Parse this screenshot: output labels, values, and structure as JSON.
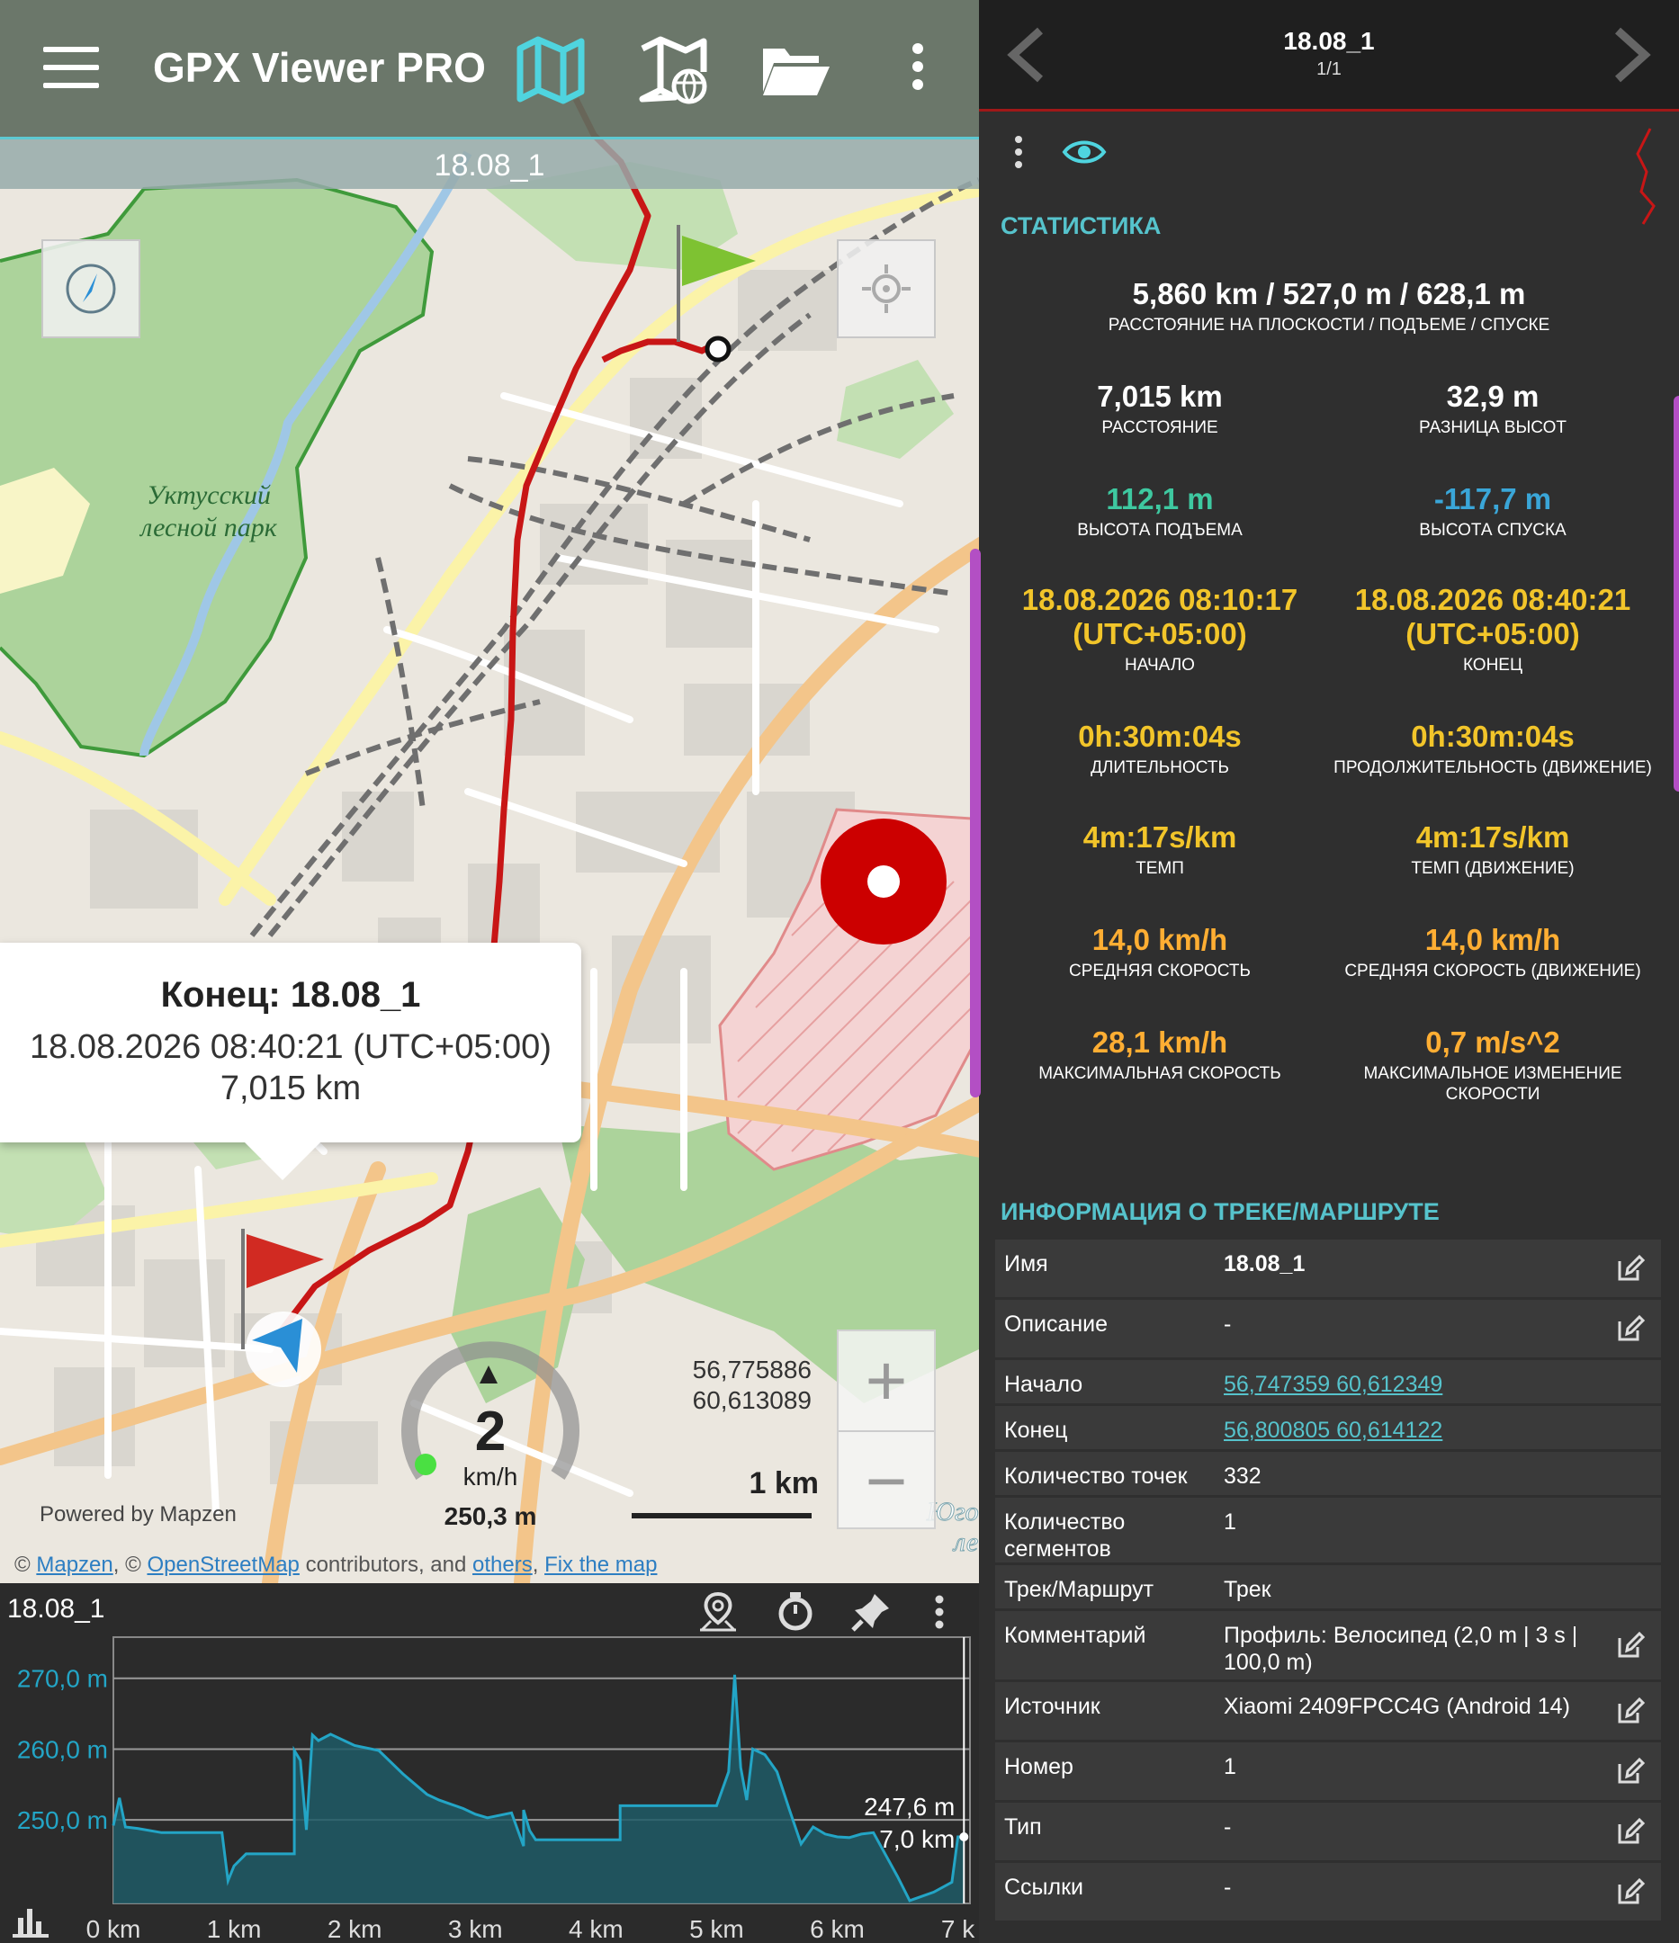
{
  "app": {
    "title": "GPX Viewer PRO",
    "track_name": "18.08_1"
  },
  "map": {
    "park_label_line1": "Уктусский",
    "park_label_line2": "лесной парк",
    "district_label_line1": "Юго-",
    "district_label_line2": "ле",
    "popup": {
      "title": "Конец: 18.08_1",
      "datetime": "18.08.2026 08:40:21 (UTC+05:00)",
      "distance": "7,015 km"
    },
    "coordinates_line1": "56,775886",
    "coordinates_line2": "60,613089",
    "speed_value": "2",
    "speed_unit": "km/h",
    "altitude": "250,3 m",
    "scale_label": "1 km",
    "zoom_in": "+",
    "zoom_out": "−",
    "powered_by": "Powered by Mapzen",
    "attribution": {
      "prefix": "©",
      "mapzen": "Mapzen",
      "sep1": ", ©",
      "osm": "OpenStreetMap",
      "mid": "contributors, and",
      "others": "others",
      "sep2": ",",
      "fix": "Fix the map"
    },
    "colors": {
      "track": "#c81616",
      "accent": "#5ec9d2",
      "park": "#a9d59a"
    }
  },
  "elevation_chart": {
    "title": "18.08_1",
    "icons": [
      "map-pin-icon",
      "stopwatch-icon",
      "pin-icon",
      "more-icon"
    ],
    "cursor_label_alt": "247,6 m",
    "cursor_label_dist": "7,0 km",
    "chart_data": {
      "type": "area",
      "title": "18.08_1",
      "xlabel": "",
      "ylabel": "",
      "ylim": [
        238.2,
        272.0
      ],
      "xlim": [
        0,
        7.1
      ],
      "y_ticks": [
        "270,0 m",
        "260,0 m",
        "250,0 m"
      ],
      "y_tick_values": [
        270,
        260,
        250
      ],
      "x_ticks": [
        "0 km",
        "1 km",
        "2 km",
        "3 km",
        "4 km",
        "5 km",
        "6 km",
        "7 k"
      ],
      "x_tick_values": [
        0,
        1,
        2,
        3,
        4,
        5,
        6,
        7
      ],
      "series": [
        {
          "name": "",
          "x": [
            0,
            0.05,
            0.1,
            0.2,
            0.4,
            0.6,
            0.9,
            0.95,
            1.0,
            1.1,
            1.2,
            1.4,
            1.5,
            1.5,
            1.55,
            1.6,
            1.65,
            1.7,
            1.8,
            2.0,
            2.2,
            2.4,
            2.6,
            2.7,
            2.8,
            2.9,
            3.0,
            3.1,
            3.3,
            3.4,
            3.4,
            3.45,
            3.5,
            3.6,
            3.8,
            4.0,
            4.2,
            4.2,
            4.5,
            4.8,
            5.0,
            5.1,
            5.15,
            5.2,
            5.25,
            5.3,
            5.4,
            5.5,
            5.6,
            5.7,
            5.8,
            5.9,
            6.0,
            6.1,
            6.2,
            6.3,
            6.5,
            6.6,
            6.8,
            6.95,
            7.0,
            7.05
          ],
          "values": [
            249.2,
            253.1,
            249.0,
            248.8,
            248.2,
            248.2,
            248.2,
            241.4,
            243.5,
            245.2,
            245.2,
            245.2,
            245.2,
            259.8,
            258.4,
            248.6,
            262.0,
            261.2,
            262.1,
            260.5,
            259.8,
            256.5,
            253.6,
            252.8,
            252.2,
            251.6,
            250.8,
            250.3,
            251.0,
            246.3,
            251.4,
            248.5,
            247.2,
            247.2,
            247.2,
            247.2,
            247.2,
            252.0,
            252.0,
            252.0,
            252.0,
            256.8,
            270.5,
            257.4,
            252.8,
            260.0,
            259.2,
            256.8,
            251.6,
            246.6,
            249.0,
            248.0,
            247.6,
            247.5,
            248.0,
            248.2,
            242.0,
            238.6,
            239.8,
            241.2,
            247.6,
            247.6
          ]
        }
      ],
      "grid": true
    }
  },
  "stats_panel": {
    "header_title": "18.08_1",
    "header_subtitle": "1/1",
    "section_stats": "СТАТИСТИКА",
    "summary_value": "5,860 km / 527,0 m / 628,1 m",
    "summary_label": "РАССТОЯНИЕ НА ПЛОСКОСТИ / ПОДЪЕМЕ / СПУСКЕ",
    "stats": [
      {
        "value": "7,015 km",
        "label": "РАССТОЯНИЕ",
        "color": "white"
      },
      {
        "value": "32,9 m",
        "label": "РАЗНИЦА ВЫСОТ",
        "color": "white"
      },
      {
        "value": "112,1 m",
        "label": "ВЫСОТА ПОДЪЕМА",
        "color": "green"
      },
      {
        "value": "-117,7 m",
        "label": "ВЫСОТА СПУСКА",
        "color": "blue"
      },
      {
        "value": "18.08.2026 08:10:17",
        "value2": "(UTC+05:00)",
        "label": "НАЧАЛО",
        "color": "yellow"
      },
      {
        "value": "18.08.2026 08:40:21",
        "value2": "(UTC+05:00)",
        "label": "КОНЕЦ",
        "color": "yellow"
      },
      {
        "value": "0h:30m:04s",
        "label": "ДЛИТЕЛЬНОСТЬ",
        "color": "yellow"
      },
      {
        "value": "0h:30m:04s",
        "label": "ПРОДОЛЖИТЕЛЬНОСТЬ (ДВИЖЕНИЕ)",
        "color": "yellow"
      },
      {
        "value": "4m:17s/km",
        "label": "ТЕМП",
        "color": "yellow"
      },
      {
        "value": "4m:17s/km",
        "label": "ТЕМП (ДВИЖЕНИЕ)",
        "color": "yellow"
      },
      {
        "value": "14,0 km/h",
        "label": "СРЕДНЯЯ СКОРОСТЬ",
        "color": "orange"
      },
      {
        "value": "14,0 km/h",
        "label": "СРЕДНЯЯ СКОРОСТЬ (ДВИЖЕНИЕ)",
        "color": "orange"
      },
      {
        "value": "28,1 km/h",
        "label": "МАКСИМАЛЬНАЯ СКОРОСТЬ",
        "color": "orange"
      },
      {
        "value": "0,7 m/s^2",
        "label": "МАКСИМАЛЬНОЕ ИЗМЕНЕНИЕ",
        "label2": "СКОРОСТИ",
        "color": "orange"
      }
    ],
    "section_info": "ИНФОРМАЦИЯ О ТРЕКЕ/МАРШРУТЕ",
    "info_rows": [
      {
        "key": "Имя",
        "value": "18.08_1",
        "editable": true,
        "style": "bold"
      },
      {
        "key": "Описание",
        "value": "-",
        "editable": true,
        "style": "plain"
      },
      {
        "key": "Начало",
        "value": "56,747359 60,612349",
        "editable": false,
        "style": "link"
      },
      {
        "key": "Конец",
        "value": "56,800805 60,614122",
        "editable": false,
        "style": "link"
      },
      {
        "key": "Количество точек",
        "value": "332",
        "editable": false,
        "style": "plain"
      },
      {
        "key": "Количество сегментов",
        "value": "1",
        "editable": false,
        "style": "plain"
      },
      {
        "key": "Трек/Маршрут",
        "value": "Трек",
        "editable": false,
        "style": "plain"
      },
      {
        "key": "Комментарий",
        "value": "Профиль: Велосипед (2,0 m | 3 s | 100,0 m)",
        "editable": true,
        "style": "plain"
      },
      {
        "key": "Источник",
        "value": "Xiaomi 2409FPCC4G (Android 14)",
        "editable": true,
        "style": "plain"
      },
      {
        "key": "Номер",
        "value": "1",
        "editable": true,
        "style": "plain"
      },
      {
        "key": "Тип",
        "value": "-",
        "editable": true,
        "style": "plain"
      },
      {
        "key": "Ссылки",
        "value": "-",
        "editable": true,
        "style": "plain"
      }
    ]
  }
}
